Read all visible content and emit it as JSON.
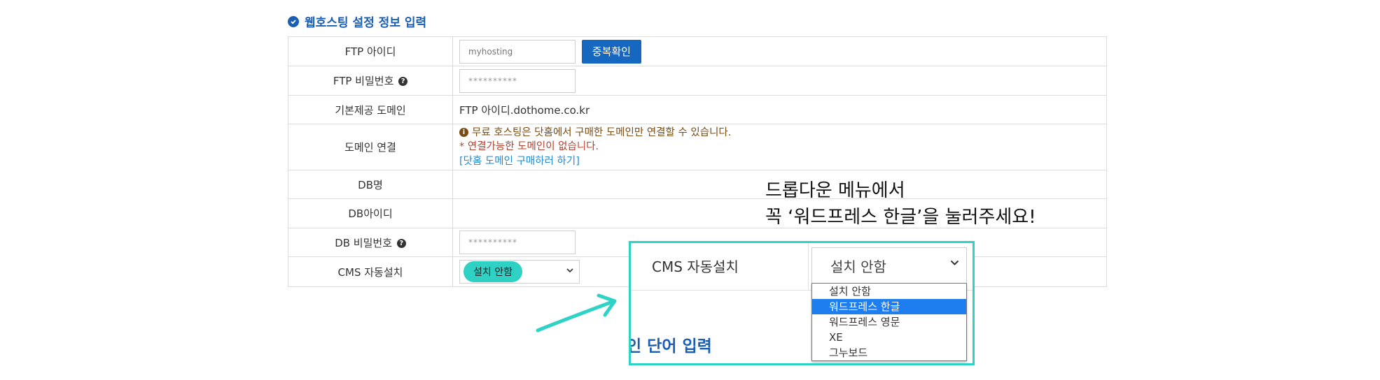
{
  "section": {
    "title": "웹호스팅 설정 정보 입력"
  },
  "form": {
    "ftp_id": {
      "label": "FTP 아이디",
      "placeholder": "myhosting",
      "check_button": "중복확인"
    },
    "ftp_password": {
      "label": "FTP 비밀번호",
      "mask": "**********"
    },
    "default_domain": {
      "label": "기본제공 도메인",
      "value": "FTP 아이디.dothome.co.kr"
    },
    "domain_link": {
      "label": "도메인 연결",
      "notice": "무료 호스팅은 닷홈에서 구매한 도메인만 연결할 수 있습니다.",
      "warning": "* 연결가능한 도메인이 없습니다.",
      "link": "[닷홈 도메인 구매하러 하기]"
    },
    "db_name": {
      "label": "DB명"
    },
    "db_id": {
      "label": "DB아이디"
    },
    "db_password": {
      "label": "DB 비밀번호",
      "mask": "**********"
    },
    "cms": {
      "label": "CMS 자동설치",
      "selected": "설치 안함"
    }
  },
  "callout": {
    "line1": "드롭다운 메뉴에서",
    "line2": "꼭 ‘워드프레스 한글’을 눌러주세요!"
  },
  "zoom": {
    "label": "CMS 자동설치",
    "selected": "설치 안함",
    "options": [
      "설치 안함",
      "워드프레스 한글",
      "워드프레스 영문",
      "XE",
      "그누보드"
    ],
    "highlighted_index": 1,
    "partial_text": "인 단어 입력"
  },
  "colors": {
    "accent": "#1a5fb4",
    "highlight": "#2fd3c5",
    "selected_option": "#1e7ef0",
    "button": "#1567c0"
  }
}
